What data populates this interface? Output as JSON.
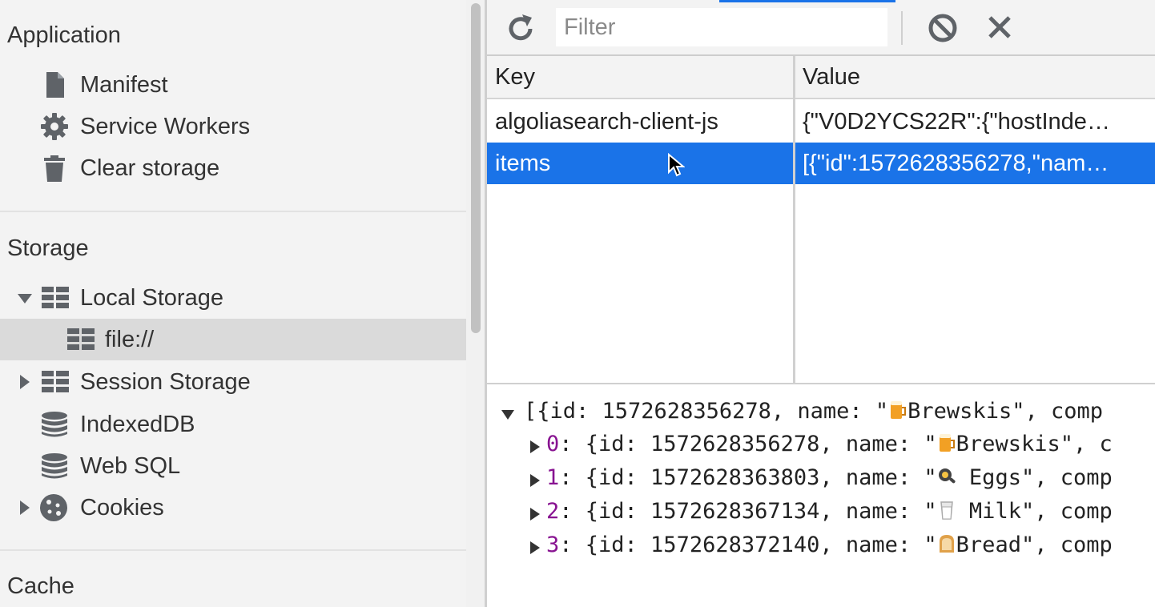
{
  "sidebar": {
    "application": {
      "title": "Application",
      "items": [
        {
          "label": "Manifest",
          "icon": "file-icon"
        },
        {
          "label": "Service Workers",
          "icon": "gear-icon"
        },
        {
          "label": "Clear storage",
          "icon": "trash-icon"
        }
      ]
    },
    "storage": {
      "title": "Storage",
      "items": [
        {
          "label": "Local Storage",
          "icon": "table-icon",
          "expanded": true
        },
        {
          "label": "file://",
          "icon": "table-icon",
          "selected": true
        },
        {
          "label": "Session Storage",
          "icon": "table-icon",
          "expanded": false
        },
        {
          "label": "IndexedDB",
          "icon": "database-icon"
        },
        {
          "label": "Web SQL",
          "icon": "database-icon"
        },
        {
          "label": "Cookies",
          "icon": "cookie-icon",
          "expanded": false
        }
      ]
    },
    "cache": {
      "title": "Cache"
    }
  },
  "toolbar": {
    "filter_placeholder": "Filter",
    "refresh_icon": "refresh-icon",
    "clear_icon": "block-icon",
    "delete_icon": "close-icon"
  },
  "table": {
    "headers": {
      "key": "Key",
      "value": "Value"
    },
    "rows": [
      {
        "key": "algoliasearch-client-js",
        "value": "{\"V0D2YCS22R\":{\"hostInde…"
      },
      {
        "key": "items",
        "value": "[{\"id\":1572628356278,\"nam…",
        "selected": true
      }
    ]
  },
  "preview": {
    "summary": {
      "prefix": "[{id: 1572628356278, name: \"",
      "emoji": "beer-emoji",
      "suffix": "Brewskis\", comp"
    },
    "entries": [
      {
        "index": "0",
        "prefix": ": {id: 1572628356278, name: \"",
        "emoji": "beer-emoji",
        "suffix": "Brewskis\", c"
      },
      {
        "index": "1",
        "prefix": ": {id: 1572628363803, name: \"",
        "emoji": "egg-emoji",
        "suffix": " Eggs\", comp"
      },
      {
        "index": "2",
        "prefix": ": {id: 1572628367134, name: \"",
        "emoji": "milk-emoji",
        "suffix": " Milk\", comp"
      },
      {
        "index": "3",
        "prefix": ": {id: 1572628372140, name: \"",
        "emoji": "bread-emoji",
        "suffix": "Bread\", comp"
      }
    ]
  },
  "colors": {
    "selection": "#1a73e8",
    "index": "#881391",
    "sidebar_bg": "#f3f3f3"
  }
}
